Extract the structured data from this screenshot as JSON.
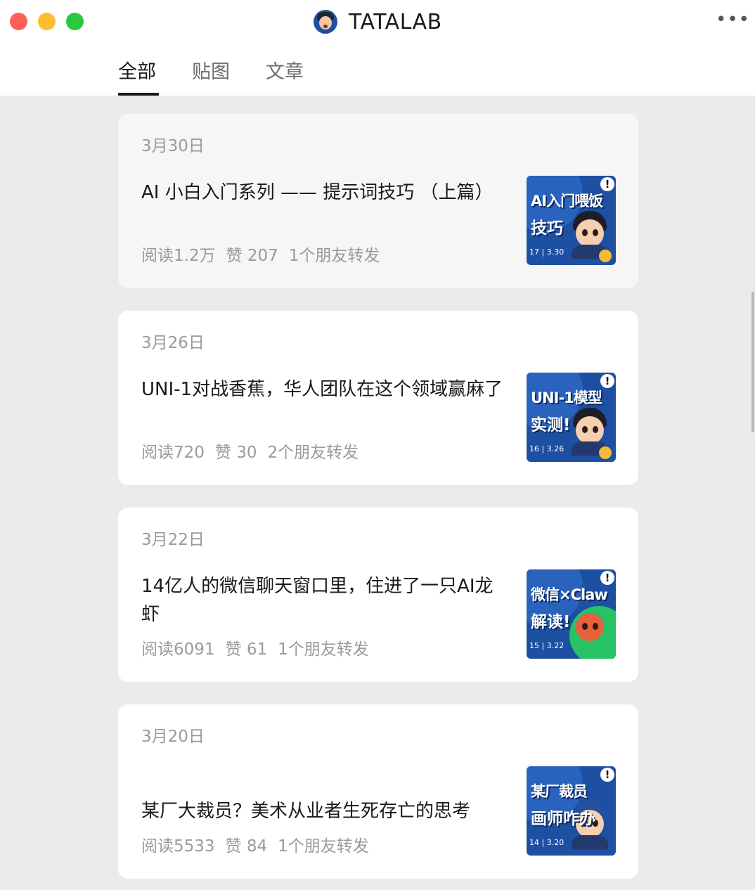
{
  "window": {
    "account_name": "TATALAB",
    "more_label": "•••",
    "colors": {
      "close": "#fe5f57",
      "minimize": "#febc2e",
      "zoom": "#28c840"
    }
  },
  "tabs": [
    {
      "label": "全部",
      "active": true
    },
    {
      "label": "贴图",
      "active": false
    },
    {
      "label": "文章",
      "active": false
    }
  ],
  "articles": [
    {
      "date": "3月30日",
      "title": "AI 小白入门系列 —— 提示词技巧 （上篇）",
      "reads": "阅读1.2万",
      "likes": "赞 207",
      "shares": "1个朋友转发",
      "thumb": {
        "line1": "AI入门喂饭",
        "line2": "技巧",
        "tag": "17 | 3.30",
        "mark": "!"
      }
    },
    {
      "date": "3月26日",
      "title": "UNI-1对战香蕉，华人团队在这个领域赢麻了",
      "reads": "阅读720",
      "likes": "赞 30",
      "shares": "2个朋友转发",
      "thumb": {
        "line1": "UNI-1模型",
        "line2": "实测!",
        "tag": "16 | 3.26",
        "mark": "!"
      }
    },
    {
      "date": "3月22日",
      "title": "14亿人的微信聊天窗口里，住进了一只AI龙虾",
      "reads": "阅读6091",
      "likes": "赞 61",
      "shares": "1个朋友转发",
      "thumb": {
        "line1": "微信×Claw",
        "line2": "解读!",
        "tag": "15 | 3.22",
        "mark": "!"
      }
    },
    {
      "date": "3月20日",
      "title": "某厂大裁员？美术从业者生死存亡的思考",
      "reads": "阅读5533",
      "likes": "赞 84",
      "shares": "1个朋友转发",
      "thumb": {
        "line1": "某厂裁员",
        "line2": "画师咋办",
        "tag": "14 | 3.20",
        "mark": "!"
      }
    }
  ]
}
